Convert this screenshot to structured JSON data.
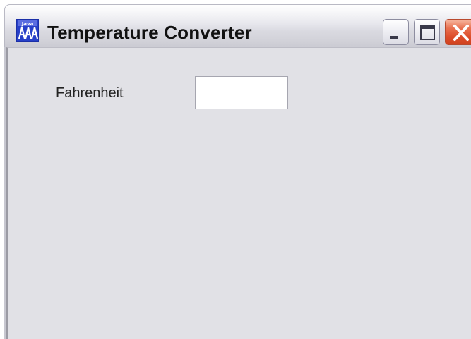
{
  "window": {
    "title": "Temperature Converter",
    "app_icon": "java-app-icon",
    "buttons": {
      "minimize": "minimize-icon",
      "maximize": "maximize-icon",
      "close": "close-icon"
    }
  },
  "form": {
    "fahrenheit_label": "Fahrenheit",
    "fahrenheit_value": ""
  },
  "colors": {
    "client_background": "#e1e1e6",
    "close_button": "#dc4d2a"
  }
}
